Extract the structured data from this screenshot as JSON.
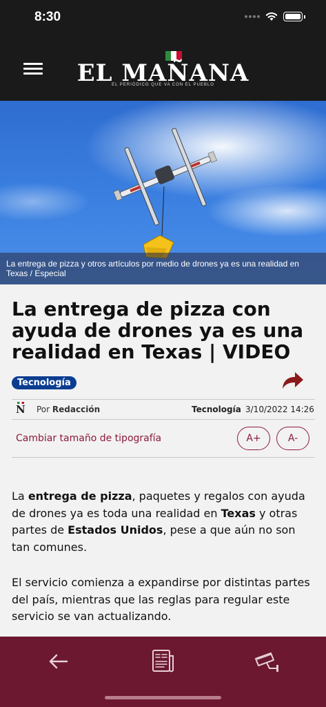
{
  "status_bar": {
    "time": "8:30"
  },
  "header": {
    "logo_text": "EL MAÑANA",
    "tagline": "EL PERIÓDICO QUE VA CON EL PUEBLO"
  },
  "hero": {
    "caption": "La entrega de pizza y otros artículos por medio de drones ya es una realidad en Texas / Especial"
  },
  "article": {
    "headline": "La entrega de pizza con ayuda de drones ya es una realidad en Texas | VIDEO",
    "tag": "Tecnología",
    "author_prefix": "Por",
    "author": "Redacción",
    "section": "Tecnología",
    "date": "3/10/2022 14:26",
    "font_size_label": "Cambiar tamaño de tipografía",
    "font_increase": "A+",
    "font_decrease": "A-",
    "p1": {
      "t1": "La ",
      "b1": "entrega de pizza",
      "t2": ", paquetes y regalos con ayuda de drones ya es toda una realidad en ",
      "b2": "Texas",
      "t3": " y otras partes de ",
      "b3": "Estados Unidos",
      "t4": ", pese a que aún no son tan comunes."
    },
    "p2": "El servicio comienza a expandirse por distintas partes del país, mientras que las reglas para regular este servicio se van actualizando."
  },
  "colors": {
    "header_bg": "#1a1a1a",
    "accent": "#8b1a3a",
    "tag_bg": "#0b3d91",
    "bottom_bar": "#6b1830"
  },
  "icons": {
    "back": "arrow-left-icon",
    "newspaper": "newspaper-icon",
    "camera": "security-camera-icon",
    "share": "share-arrow-icon"
  }
}
